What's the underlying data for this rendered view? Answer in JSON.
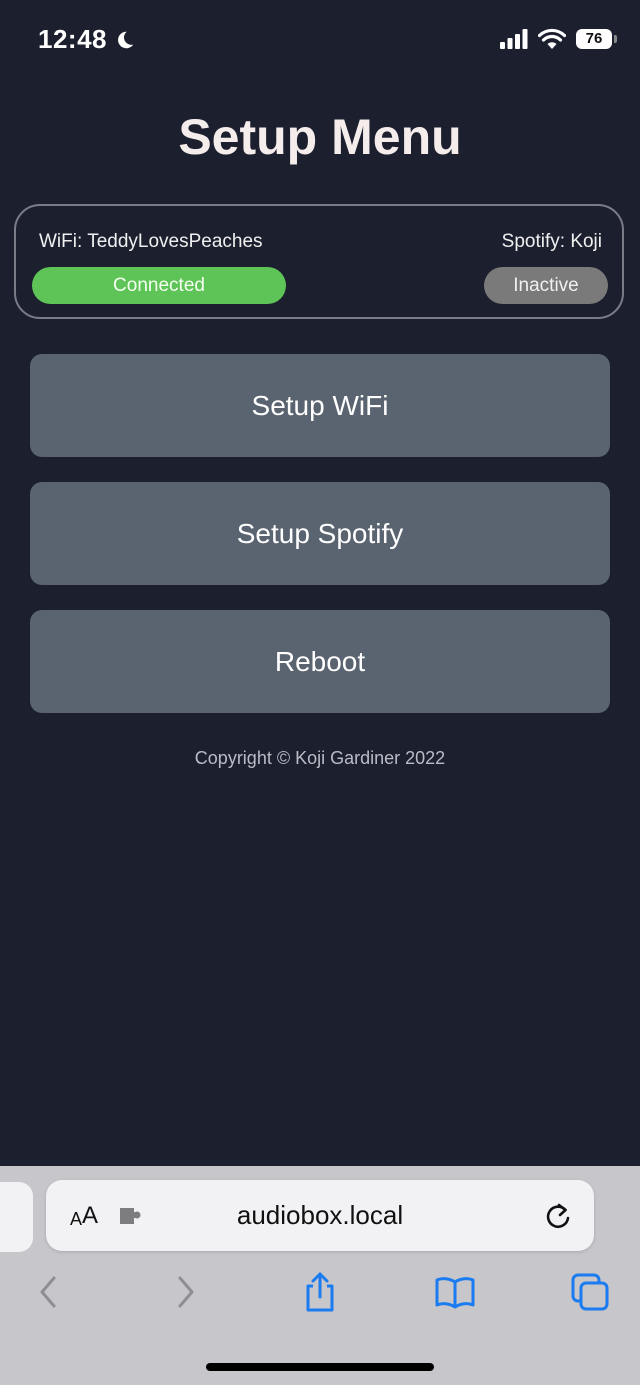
{
  "status_bar": {
    "time": "12:48",
    "battery": "76"
  },
  "page": {
    "title": "Setup Menu",
    "copyright": "Copyright © Koji Gardiner 2022"
  },
  "status_card": {
    "wifi_label": "WiFi: TeddyLovesPeaches",
    "wifi_status": "Connected",
    "spotify_label": "Spotify: Koji",
    "spotify_status": "Inactive"
  },
  "buttons": {
    "setup_wifi": "Setup WiFi",
    "setup_spotify": "Setup Spotify",
    "reboot": "Reboot"
  },
  "browser": {
    "aa_small": "A",
    "aa_large": "A",
    "url": "audiobox.local"
  },
  "colors": {
    "background": "#1c1f2e",
    "button": "#5a6370",
    "connected": "#5fc457",
    "inactive": "#7a7a7a",
    "browser_accent": "#1a7cf0"
  }
}
